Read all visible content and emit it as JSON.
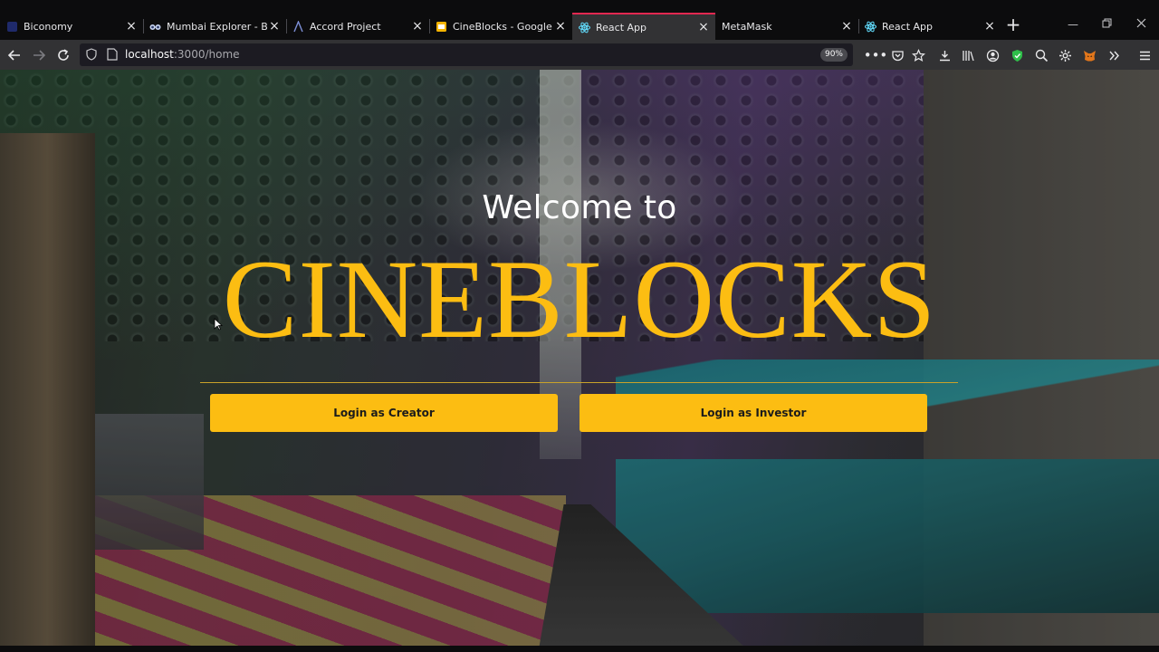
{
  "browser": {
    "tabs": [
      {
        "title": "Biconomy",
        "icon": "biconomy-favicon",
        "active": false
      },
      {
        "title": "Mumbai Explorer - Bloc",
        "icon": "binoculars-favicon",
        "active": false
      },
      {
        "title": "Accord Project",
        "icon": "accord-favicon",
        "active": false
      },
      {
        "title": "CineBlocks - Google Slid",
        "icon": "slides-favicon",
        "active": false
      },
      {
        "title": "React App",
        "icon": "react-favicon",
        "active": true
      },
      {
        "title": "MetaMask",
        "icon": "none",
        "active": false
      },
      {
        "title": "React App",
        "icon": "react-favicon",
        "active": false
      }
    ],
    "url": {
      "host": "localhost",
      "path": ":3000/home"
    },
    "zoom": "90%",
    "colors": {
      "active_tab_accent": "#e22850",
      "toolbar": "#323234",
      "tabstrip": "#0c0c0d"
    }
  },
  "page": {
    "welcome": "Welcome to",
    "brand": "CINEBLOCKS",
    "buttons": {
      "creator": "Login as Creator",
      "investor": "Login as Investor"
    },
    "colors": {
      "brand": "#fcbd12",
      "button_bg": "#fcbd12"
    }
  }
}
